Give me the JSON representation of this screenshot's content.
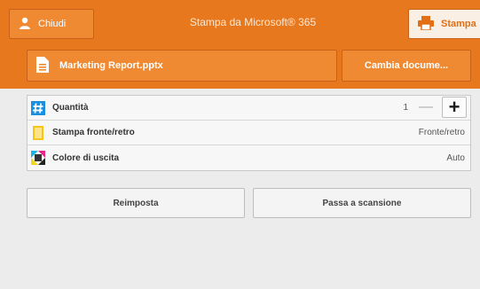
{
  "header": {
    "close_label": "Chiudi",
    "title": "Stampa da Microsoft® 365",
    "print_label": "Stampa"
  },
  "document": {
    "file_name": "Marketing Report.pptx",
    "change_label": "Cambia docume..."
  },
  "settings": {
    "quantity": {
      "label": "Quantità",
      "value": "1",
      "minus": "—",
      "plus": "+"
    },
    "duplex": {
      "label": "Stampa fronte/retro",
      "value": "Fronte/retro"
    },
    "color": {
      "label": "Colore di uscita",
      "value": "Auto"
    }
  },
  "actions": {
    "reset_label": "Reimposta",
    "scan_label": "Passa a scansione"
  },
  "colors": {
    "accent": "#e8781e",
    "accent_light": "#f08a32"
  }
}
